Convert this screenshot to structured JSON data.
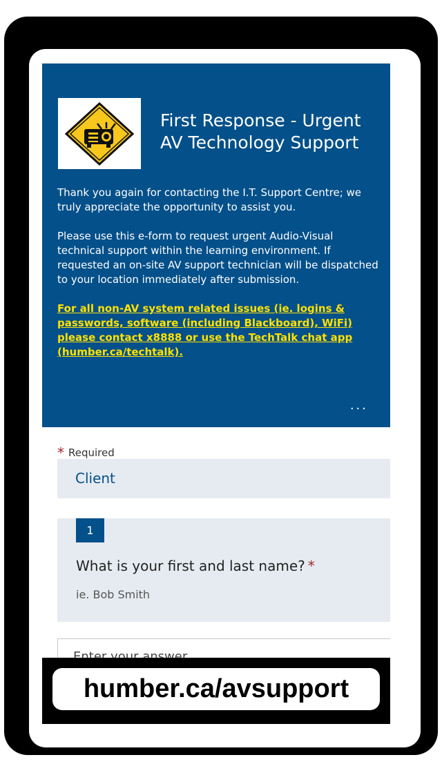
{
  "form": {
    "title": "First Response - Urgent AV Technology Support",
    "description": {
      "paragraph1": "Thank you again for contacting the I.T. Support Centre; we truly appreciate the opportunity to assist you.",
      "paragraph2": "Please use this e-form to request urgent Audio-Visual technical support within the learning environment.  If requested an on-site AV support technician will be dispatched to your location immediately after submission.",
      "warning": "For all non-AV system related issues (ie. logins & passwords, software (including Blackboard), WiFi) please contact x8888 or use the TechTalk chat app (humber.ca/techtalk)."
    },
    "more_label": "...",
    "required_star": "*",
    "required_label": "Required",
    "section_title": "Client"
  },
  "question1": {
    "number": "1",
    "text": "What is your first and last name?",
    "required_star": "*",
    "hint": "ie. Bob Smith",
    "placeholder": "Enter your answer"
  },
  "banner": {
    "url": "humber.ca/avsupport"
  },
  "colors": {
    "header_bg": "#04508a",
    "warning_text": "#ffe100",
    "required_star": "#a4262c",
    "section_bg": "#e6ebf1"
  },
  "icons": {
    "logo": "projector-warning-sign-icon"
  }
}
